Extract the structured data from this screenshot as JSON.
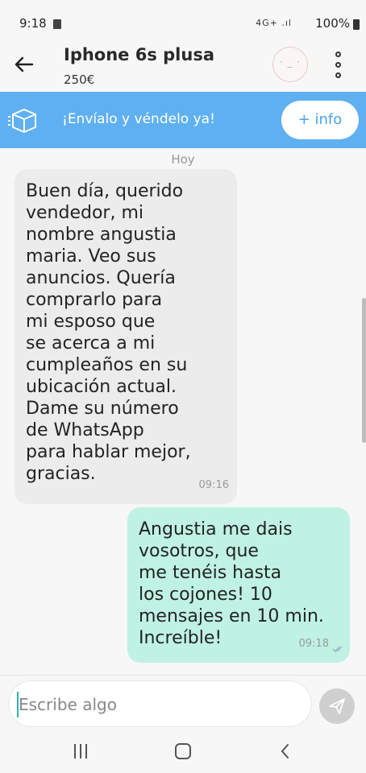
{
  "status_bar": {
    "time": "9:18",
    "network": "4G+ .ıl",
    "battery": "100%"
  },
  "header": {
    "title": "Iphone 6s plusa",
    "price": "250€"
  },
  "promo": {
    "text": "¡Envíalo y véndelo ya!",
    "button_label": "+ info",
    "color": "#5fb0f1"
  },
  "chat": {
    "date_label": "Hoy",
    "messages": [
      {
        "direction": "received",
        "text": "Buen día, querido\nvendedor, mi\nnombre angustia\nmaria. Veo sus\nanuncios. Quería\ncomprarlo para\nmi esposo que\nse acerca a mi\ncumpleaños en su\nubicación actual.\nDame su número\nde WhatsApp\npara hablar mejor,\ngracias.",
        "time": "09:16",
        "color": "#ececec"
      },
      {
        "direction": "sent",
        "text": "Angustia me dais\nvosotros, que\nme tenéis hasta\nlos cojones! 10\nmensajes en 10 min.\nIncreíble!",
        "time": "09:18",
        "color": "#bff2e3"
      }
    ]
  },
  "composer": {
    "placeholder": "Escribe algo"
  },
  "icons": {
    "back": "arrow-left-icon",
    "menu": "more-vertical-icon",
    "promo": "shipping-box-icon",
    "send": "send-icon",
    "nav_recents": "recents-icon",
    "nav_home": "home-icon",
    "nav_back": "chevron-left-icon"
  }
}
